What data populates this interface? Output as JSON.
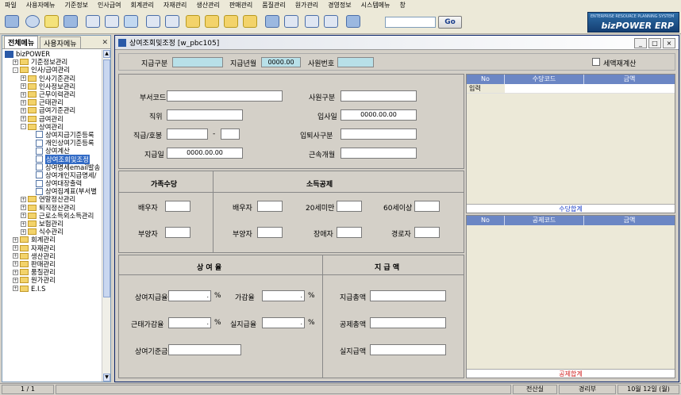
{
  "menu": [
    "파일",
    "사용자메뉴",
    "기준정보",
    "인사급여",
    "회계관리",
    "자재관리",
    "생산관리",
    "판매관리",
    "품질관리",
    "원가관리",
    "경영정보",
    "시스템메뉴",
    "창"
  ],
  "toolbar": {
    "go_label": "Go",
    "logo_sub": "ENTERPRISE RESOURCE PLANNING SYSTEM",
    "logo_main": "bizPOWER ERP"
  },
  "leftpanel": {
    "tabs": [
      "전체메뉴",
      "사용자메뉴"
    ],
    "tree": [
      {
        "label": "bizPOWER",
        "level": 0,
        "kind": "root",
        "exp": ""
      },
      {
        "label": "기준정보관리",
        "level": 1,
        "kind": "folder",
        "exp": "+"
      },
      {
        "label": "인사/급여관리",
        "level": 1,
        "kind": "folder",
        "exp": "-"
      },
      {
        "label": "인사기준관리",
        "level": 2,
        "kind": "folder",
        "exp": "+"
      },
      {
        "label": "인사정보관리",
        "level": 2,
        "kind": "folder",
        "exp": "+"
      },
      {
        "label": "근무이력관리",
        "level": 2,
        "kind": "folder",
        "exp": "+"
      },
      {
        "label": "근태관리",
        "level": 2,
        "kind": "folder",
        "exp": "+"
      },
      {
        "label": "급여기준관리",
        "level": 2,
        "kind": "folder",
        "exp": "+"
      },
      {
        "label": "급여관리",
        "level": 2,
        "kind": "folder",
        "exp": "+"
      },
      {
        "label": "상여관리",
        "level": 2,
        "kind": "folder",
        "exp": "-"
      },
      {
        "label": "상여지급기준등록",
        "level": 3,
        "kind": "doc",
        "exp": ""
      },
      {
        "label": "개인상여기준등록",
        "level": 3,
        "kind": "doc",
        "exp": ""
      },
      {
        "label": "상여계산",
        "level": 3,
        "kind": "doc",
        "exp": ""
      },
      {
        "label": "상여조회및조정",
        "level": 3,
        "kind": "doc",
        "exp": "",
        "selected": true
      },
      {
        "label": "상여명세email발송",
        "level": 3,
        "kind": "doc",
        "exp": ""
      },
      {
        "label": "상여개인지급명세/",
        "level": 3,
        "kind": "doc",
        "exp": ""
      },
      {
        "label": "상여대장출력",
        "level": 3,
        "kind": "doc",
        "exp": ""
      },
      {
        "label": "상여집계표(부서별",
        "level": 3,
        "kind": "doc",
        "exp": ""
      },
      {
        "label": "연말정산관리",
        "level": 2,
        "kind": "folder",
        "exp": "+"
      },
      {
        "label": "퇴직정산관리",
        "level": 2,
        "kind": "folder",
        "exp": "+"
      },
      {
        "label": "근로소득외소득관리",
        "level": 2,
        "kind": "folder",
        "exp": "+"
      },
      {
        "label": "보험관리",
        "level": 2,
        "kind": "folder",
        "exp": "+"
      },
      {
        "label": "식수관리",
        "level": 2,
        "kind": "folder",
        "exp": "+"
      },
      {
        "label": "회계관리",
        "level": 1,
        "kind": "folder",
        "exp": "+"
      },
      {
        "label": "자재관리",
        "level": 1,
        "kind": "folder",
        "exp": "+"
      },
      {
        "label": "생산관리",
        "level": 1,
        "kind": "folder",
        "exp": "+"
      },
      {
        "label": "판매관리",
        "level": 1,
        "kind": "folder",
        "exp": "+"
      },
      {
        "label": "품질관리",
        "level": 1,
        "kind": "folder",
        "exp": "+"
      },
      {
        "label": "원가관리",
        "level": 1,
        "kind": "folder",
        "exp": "+"
      },
      {
        "label": "E.I.S",
        "level": 1,
        "kind": "folder",
        "exp": "+"
      }
    ]
  },
  "window": {
    "title": "상여조회및조정 [w_pbc105]",
    "btn_min": "_",
    "btn_max": "□",
    "btn_close": "×"
  },
  "header": {
    "pay_type_label": "지급구분",
    "pay_type_value": "",
    "pay_month_label": "지급년월",
    "pay_month_value": "0000.00",
    "emp_no_label": "사원번호",
    "emp_no_value": "",
    "tax_recalc_label": "세액재계산"
  },
  "info": {
    "dept_code_label": "부서코드",
    "emp_type_label": "사원구분",
    "position_label": "직위",
    "hire_date_label": "입사일",
    "hire_date_value": "0000.00.00",
    "grade_label": "직급/호봉",
    "grade_sep": "-",
    "resign_type_label": "입퇴사구분",
    "pay_date_label": "지급일",
    "pay_date_value": "0000.00.00",
    "service_months_label": "근속개월"
  },
  "family": {
    "title": "가족수당",
    "spouse_label": "배우자",
    "dependent_label": "부양자"
  },
  "deduction": {
    "title": "소득공제",
    "spouse_label": "배우자",
    "under20_label": "20세미만",
    "over60_label": "60세이상",
    "dependent_label": "부양자",
    "disabled_label": "장애자",
    "elderly_label": "경로자"
  },
  "bonus_rate": {
    "title": "상 여 율",
    "pay_rate_label": "상여지급율",
    "add_reduce_rate_label": "가감율",
    "attendance_rate_label": "근태가감율",
    "actual_rate_label": "실지급율",
    "base_amount_label": "상여기준금",
    "pct": "%",
    "dot": "."
  },
  "payment": {
    "title": "지 급 액",
    "total_pay_label": "지급총액",
    "total_deduct_label": "공제총액",
    "net_pay_label": "실지급액"
  },
  "allowance_grid": {
    "headers": [
      "No",
      "수당코드",
      "금액"
    ],
    "row_label": "입력",
    "footer": "수당합계"
  },
  "deduct_grid": {
    "headers": [
      "No",
      "공제코드",
      "금액"
    ],
    "footer": "공제합계"
  },
  "status": {
    "page": "1 / 1",
    "dept_cost": "전산실",
    "dept_admin": "경리부",
    "date": "10월 12일 (월)"
  },
  "colors": {
    "grid_header": "#6b86c4",
    "readonly_field": "#b8e0e8",
    "allowance_footer": "#1a3ec8",
    "deduct_footer": "#d02020"
  }
}
